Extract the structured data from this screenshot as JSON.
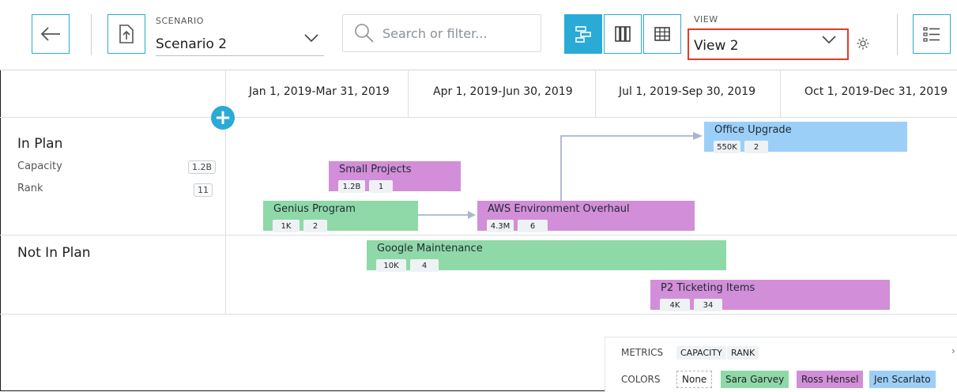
{
  "toolbar": {
    "scenario_label": "SCENARIO",
    "scenario_value": "Scenario 2",
    "search_placeholder": "Search or filter...",
    "view_label": "VIEW",
    "view_value": "View 2"
  },
  "timeline": {
    "periods": [
      "Jan 1, 2019-Mar 31, 2019",
      "Apr 1, 2019-Jun 30, 2019",
      "Jul 1, 2019-Sep 30, 2019",
      "Oct 1, 2019-Dec 31, 2019"
    ]
  },
  "lanes": {
    "in_plan": {
      "title": "In Plan",
      "capacity_label": "Capacity",
      "capacity_value": "1.2B",
      "rank_label": "Rank",
      "rank_value": "11"
    },
    "not_in_plan": {
      "title": "Not In Plan"
    }
  },
  "items": {
    "office_upgrade": {
      "title": "Office Upgrade",
      "capacity": "550K",
      "rank": "2"
    },
    "small_projects": {
      "title": "Small Projects",
      "capacity": "1.2B",
      "rank": "1"
    },
    "genius_program": {
      "title": "Genius Program",
      "capacity": "1K",
      "rank": "2"
    },
    "aws_overhaul": {
      "title": "AWS Environment Overhaul",
      "capacity": "4.3M",
      "rank": "6"
    },
    "google_maintenance": {
      "title": "Google Maintenance",
      "capacity": "10K",
      "rank": "4"
    },
    "p2_ticketing": {
      "title": "P2 Ticketing Items",
      "capacity": "4K",
      "rank": "34"
    }
  },
  "legend": {
    "metrics_label": "METRICS",
    "metrics": [
      "CAPACITY",
      "RANK"
    ],
    "colors_label": "COLORS",
    "colors": [
      "None",
      "Sara Garvey",
      "Ross Hensel",
      "Jen Scarlato"
    ],
    "color_values": {
      "sara_garvey": "#8fd9a8",
      "ross_hensel": "#d28ed8",
      "jen_scarlato": "#9ccff7"
    }
  },
  "theme": {
    "accent": "#2aaad6",
    "highlight_box": "#e53a2b"
  }
}
